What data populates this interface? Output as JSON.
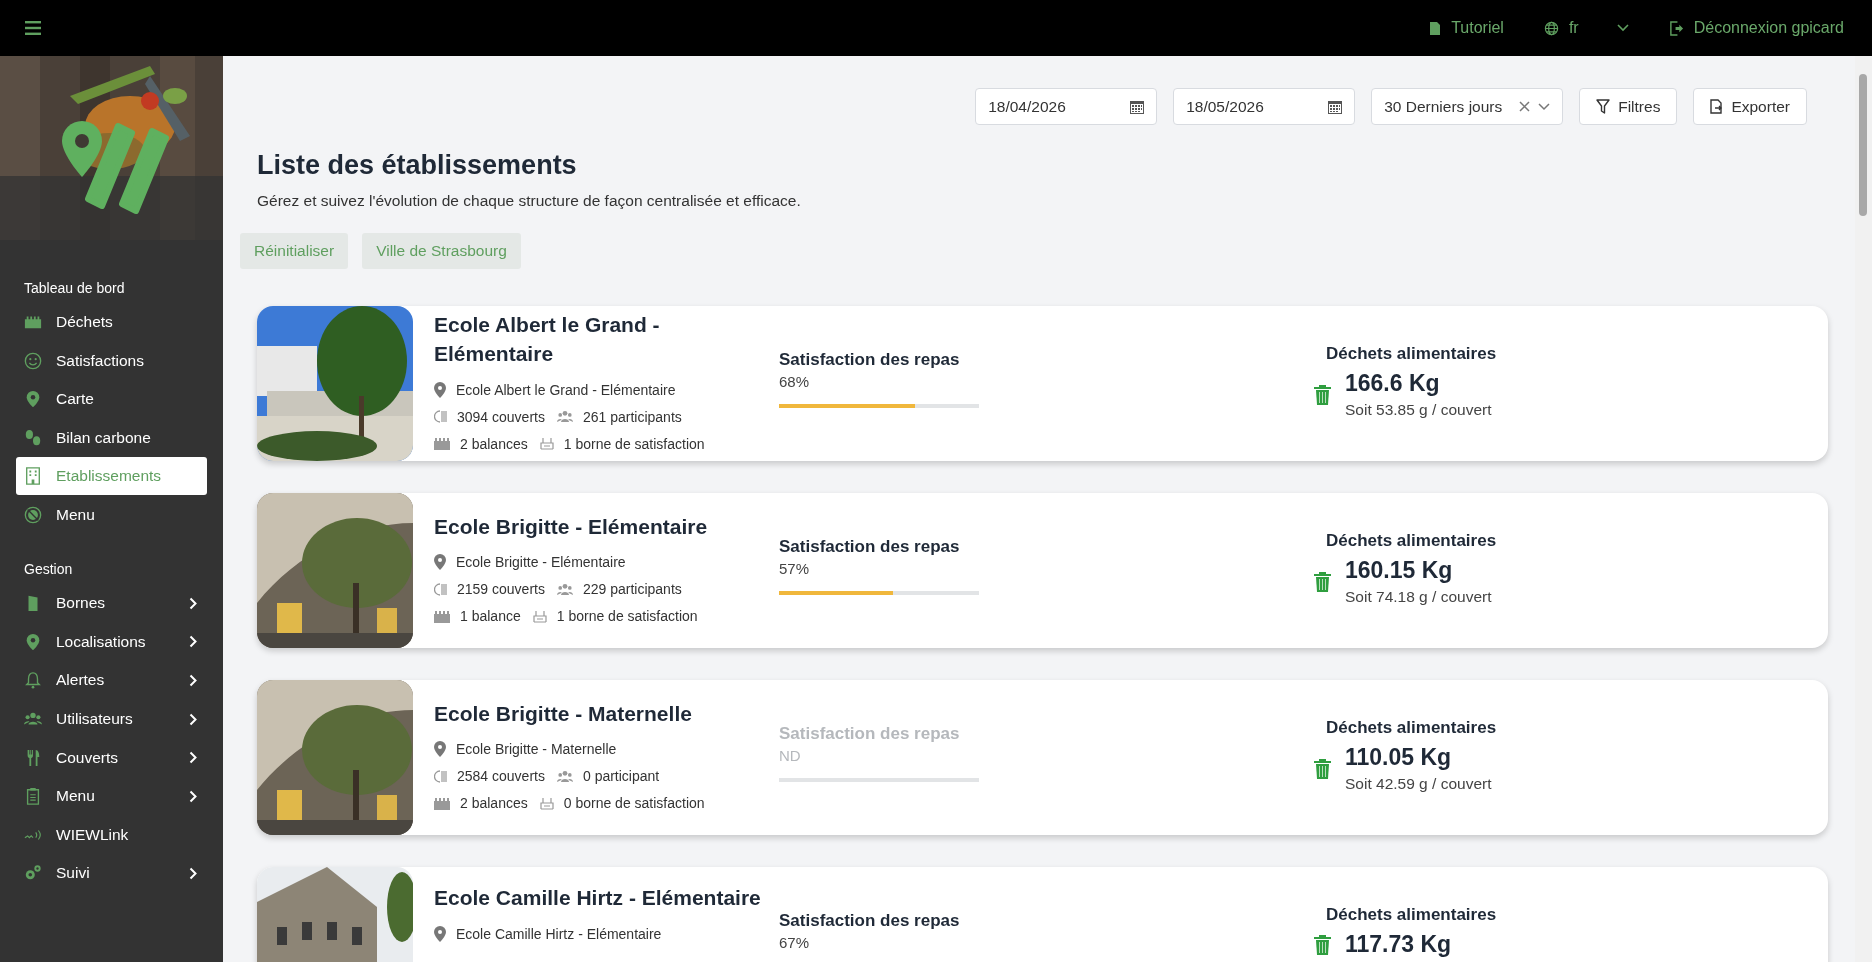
{
  "top_bar": {
    "tutorial": "Tutoriel",
    "language": "fr",
    "logout": "Déconnexion gpicard"
  },
  "sidebar": {
    "sections": [
      {
        "title": "Tableau de bord",
        "items": [
          {
            "label": "Déchets",
            "selected": false,
            "expandable": false
          },
          {
            "label": "Satisfactions",
            "selected": false,
            "expandable": false
          },
          {
            "label": "Carte",
            "selected": false,
            "expandable": false
          },
          {
            "label": "Bilan carbone",
            "selected": false,
            "expandable": false
          },
          {
            "label": "Etablissements",
            "selected": true,
            "expandable": false
          },
          {
            "label": "Menu",
            "selected": false,
            "expandable": false
          }
        ]
      },
      {
        "title": "Gestion",
        "items": [
          {
            "label": "Bornes",
            "selected": false,
            "expandable": true
          },
          {
            "label": "Localisations",
            "selected": false,
            "expandable": true
          },
          {
            "label": "Alertes",
            "selected": false,
            "expandable": true
          },
          {
            "label": "Utilisateurs",
            "selected": false,
            "expandable": true
          },
          {
            "label": "Couverts",
            "selected": false,
            "expandable": true
          },
          {
            "label": "Menu",
            "selected": false,
            "expandable": true
          },
          {
            "label": "WIEWLink",
            "selected": false,
            "expandable": false
          },
          {
            "label": "Suivi",
            "selected": false,
            "expandable": true
          }
        ]
      }
    ]
  },
  "filters": {
    "date_from": "18/04/2026",
    "date_to": "18/05/2026",
    "period": "30 Derniers jours",
    "buttons": [
      {
        "kind": "filter",
        "label": "Filtres"
      },
      {
        "kind": "export",
        "label": "Exporter"
      }
    ]
  },
  "page": {
    "title": "Liste des établissements",
    "subtitle": "Gérez et suivez l'évolution de chaque structure de façon centralisée et efficace.",
    "chips": [
      "Réinitialiser",
      "Ville de Strasbourg"
    ]
  },
  "establishments": [
    {
      "name": "Ecole Albert le Grand - Elémentaire",
      "address": "Ecole Albert le Grand - Elémentaire",
      "covers": "3094 couverts",
      "participants": "261 participants",
      "scales": "2 balances",
      "kiosks": "1 borne de satisfaction",
      "satisfaction": {
        "label": "Satisfaction des repas",
        "value": "68%",
        "available": true,
        "level": 0.68
      },
      "waste": {
        "label": "Déchets alimentaires",
        "amount": "166.6 Kg",
        "per_cover": "Soit 53.85 g / couvert"
      }
    },
    {
      "name": "Ecole Brigitte - Elémentaire",
      "address": "Ecole Brigitte - Elémentaire",
      "covers": "2159 couverts",
      "participants": "229 participants",
      "scales": "1 balance",
      "kiosks": "1 borne de satisfaction",
      "satisfaction": {
        "label": "Satisfaction des repas",
        "value": "57%",
        "available": true,
        "level": 0.57
      },
      "waste": {
        "label": "Déchets alimentaires",
        "amount": "160.15 Kg",
        "per_cover": "Soit 74.18 g / couvert"
      }
    },
    {
      "name": "Ecole Brigitte - Maternelle",
      "address": "Ecole Brigitte - Maternelle",
      "covers": "2584 couverts",
      "participants": "0 participant",
      "scales": "2 balances",
      "kiosks": "0 borne de satisfaction",
      "satisfaction": {
        "label": "Satisfaction des repas",
        "value": "ND",
        "available": false
      },
      "waste": {
        "label": "Déchets alimentaires",
        "amount": "110.05 Kg",
        "per_cover": "Soit 42.59 g / couvert"
      }
    },
    {
      "name": "Ecole Camille Hirtz - Elémentaire",
      "address": "Ecole Camille Hirtz - Elémentaire",
      "satisfaction": {
        "label": "Satisfaction des repas",
        "value": "67%",
        "available": true
      },
      "waste": {
        "label": "Déchets alimentaires",
        "amount": "117.73 Kg"
      }
    }
  ]
}
